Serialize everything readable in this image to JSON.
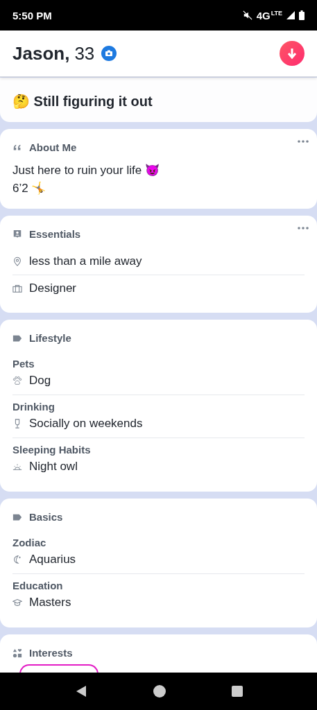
{
  "status_bar": {
    "time": "5:50 PM",
    "network": "4G",
    "network_sup": "LTE"
  },
  "header": {
    "name": "Jason,",
    "age": "33",
    "verified": true
  },
  "looking_for": {
    "text": "Still figuring it out",
    "emoji": "🤔"
  },
  "sections": [
    {
      "kind": "text",
      "title": "About Me",
      "more": true,
      "lines": [
        "Just here to ruin your life 😈",
        "6’2 🤸"
      ]
    },
    {
      "kind": "list",
      "title": "Essentials",
      "more": true,
      "items": [
        "less than a mile away",
        "Designer"
      ]
    },
    {
      "kind": "groups",
      "title": "Lifestyle",
      "more": false,
      "groups": [
        {
          "label": "Pets",
          "value": "Dog"
        },
        {
          "label": "Drinking",
          "value": "Socially on weekends"
        },
        {
          "label": "Sleeping Habits",
          "value": "Night owl"
        }
      ]
    },
    {
      "kind": "groups",
      "title": "Basics",
      "more": false,
      "groups": [
        {
          "label": "Zodiac",
          "value": "Aquarius"
        },
        {
          "label": "Education",
          "value": "Masters"
        }
      ]
    },
    {
      "kind": "tags",
      "title": "Interests",
      "more": false
    }
  ]
}
